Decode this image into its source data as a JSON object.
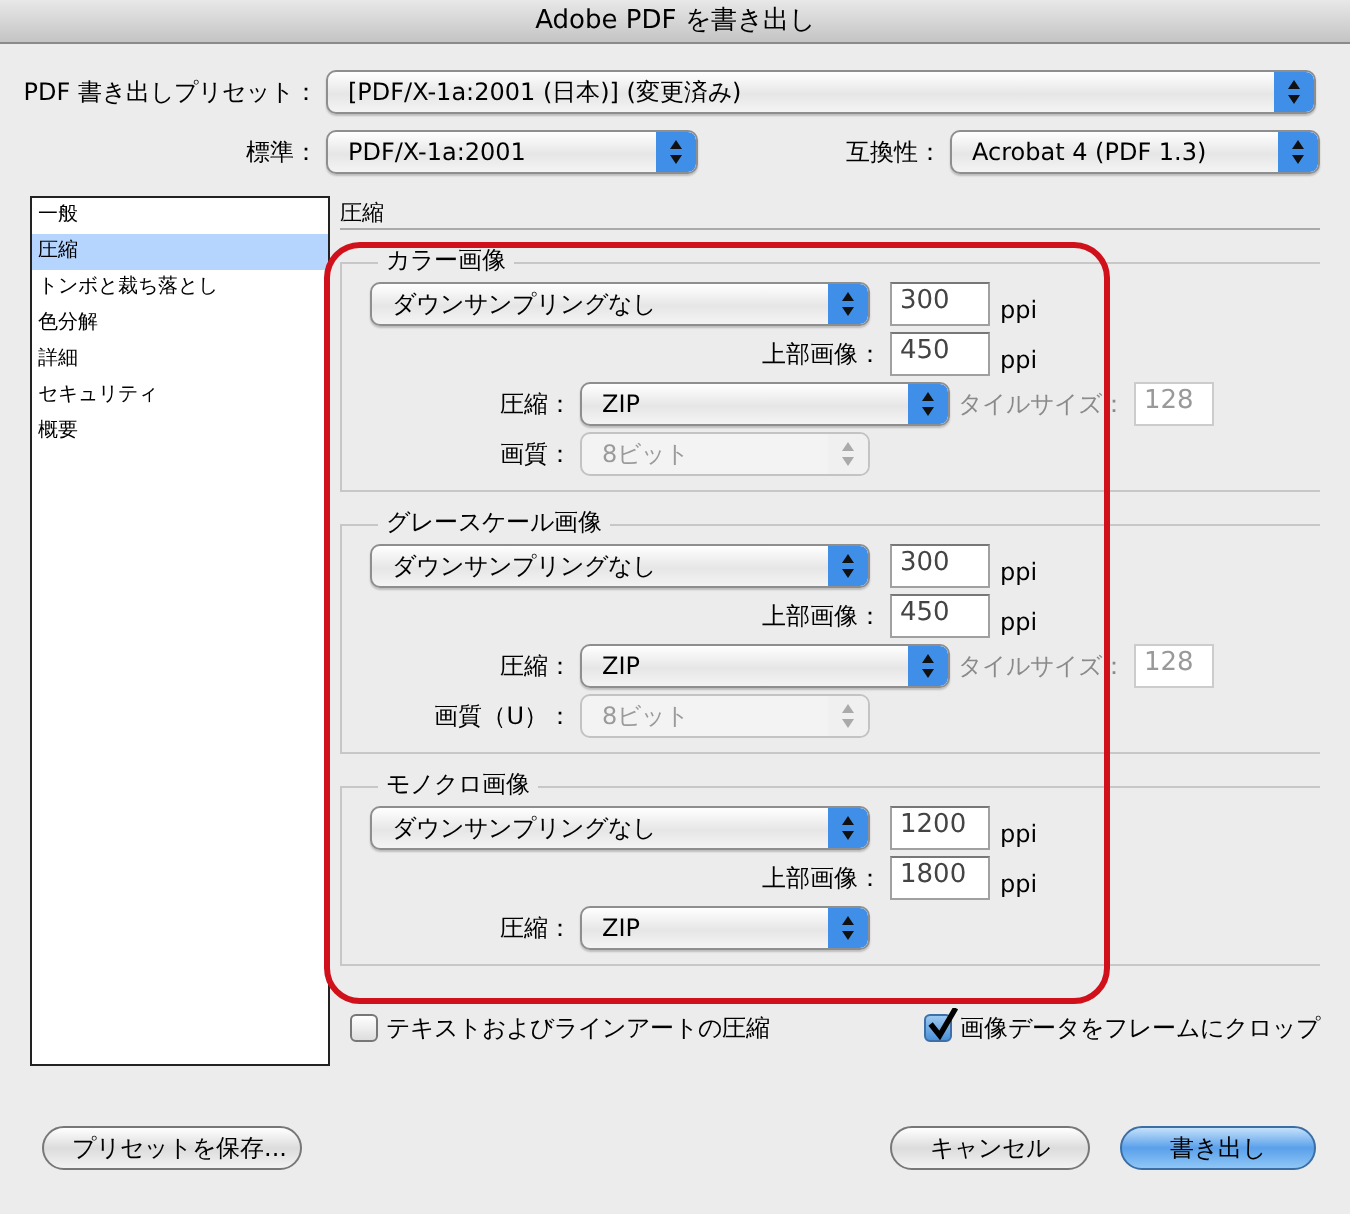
{
  "window": {
    "title": "Adobe PDF を書き出し"
  },
  "preset": {
    "label": "PDF 書き出しプリセット：",
    "value": "[PDF/X-1a:2001 (日本)] (変更済み)"
  },
  "standard": {
    "label": "標準：",
    "value": "PDF/X-1a:2001"
  },
  "compatibility": {
    "label": "互換性：",
    "value": "Acrobat 4 (PDF 1.3)"
  },
  "sidebar": {
    "items": [
      {
        "label": "一般",
        "selected": false
      },
      {
        "label": "圧縮",
        "selected": true
      },
      {
        "label": "トンボと裁ち落とし",
        "selected": false
      },
      {
        "label": "色分解",
        "selected": false
      },
      {
        "label": "詳細",
        "selected": false
      },
      {
        "label": "セキュリティ",
        "selected": false
      },
      {
        "label": "概要",
        "selected": false
      }
    ]
  },
  "section_title": "圧縮",
  "groups": [
    {
      "title": "カラー画像",
      "sampling": "ダウンサンプリングなし",
      "resolution": "300",
      "resolution_unit": "ppi",
      "above_label": "上部画像：",
      "above": "450",
      "above_unit": "ppi",
      "compression_label": "圧縮：",
      "compression": "ZIP",
      "tile": {
        "label": "タイルサイズ：",
        "value": "128",
        "disabled": true
      },
      "quality": {
        "label": "画質：",
        "value": "8ビット",
        "disabled": true
      }
    },
    {
      "title": "グレースケール画像",
      "sampling": "ダウンサンプリングなし",
      "resolution": "300",
      "resolution_unit": "ppi",
      "above_label": "上部画像：",
      "above": "450",
      "above_unit": "ppi",
      "compression_label": "圧縮：",
      "compression": "ZIP",
      "tile": {
        "label": "タイルサイズ：",
        "value": "128",
        "disabled": true
      },
      "quality": {
        "label": "画質（U）：",
        "value": "8ビット",
        "disabled": true
      }
    },
    {
      "title": "モノクロ画像",
      "sampling": "ダウンサンプリングなし",
      "resolution": "1200",
      "resolution_unit": "ppi",
      "above_label": "上部画像：",
      "above": "1800",
      "above_unit": "ppi",
      "compression_label": "圧縮：",
      "compression": "ZIP"
    }
  ],
  "checkboxes": [
    {
      "label": "テキストおよびラインアートの圧縮",
      "checked": false
    },
    {
      "label": "画像データをフレームにクロップ",
      "checked": true
    }
  ],
  "buttons": [
    {
      "label": "プリセットを保存...",
      "kind": "normal"
    },
    {
      "label": "キャンセル",
      "kind": "normal"
    },
    {
      "label": "書き出し",
      "kind": "default"
    }
  ]
}
